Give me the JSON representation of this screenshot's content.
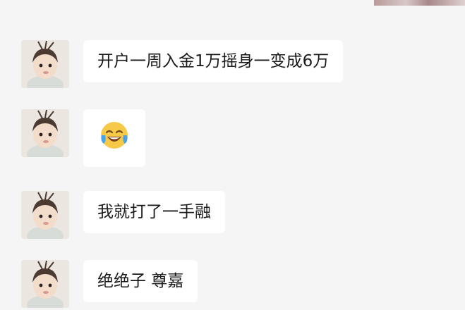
{
  "messages": [
    {
      "text": "开户一周入金1万摇身一变成6万",
      "type": "text"
    },
    {
      "text": "😂",
      "type": "emoji",
      "emoji_name": "face-with-tears-of-joy"
    },
    {
      "text": "我就打了一手融",
      "type": "text"
    },
    {
      "text": "绝绝子 尊嘉",
      "type": "text"
    }
  ],
  "colors": {
    "background": "#f5f5f5",
    "bubble": "#ffffff",
    "text": "#1a1a1a"
  }
}
